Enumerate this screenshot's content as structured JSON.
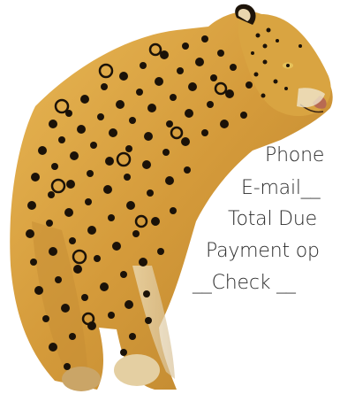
{
  "form": {
    "phone_label": "Phone",
    "email_label": "E-mail__",
    "total_label": "Total Due",
    "payment_label": "Payment op",
    "check_label": "__Check  __"
  },
  "image": {
    "subject": "leopard-photo"
  },
  "colors": {
    "background": "#ffffff",
    "text": "#2a2a2a",
    "fur": "#d9a441",
    "spots": "#1b1208"
  }
}
